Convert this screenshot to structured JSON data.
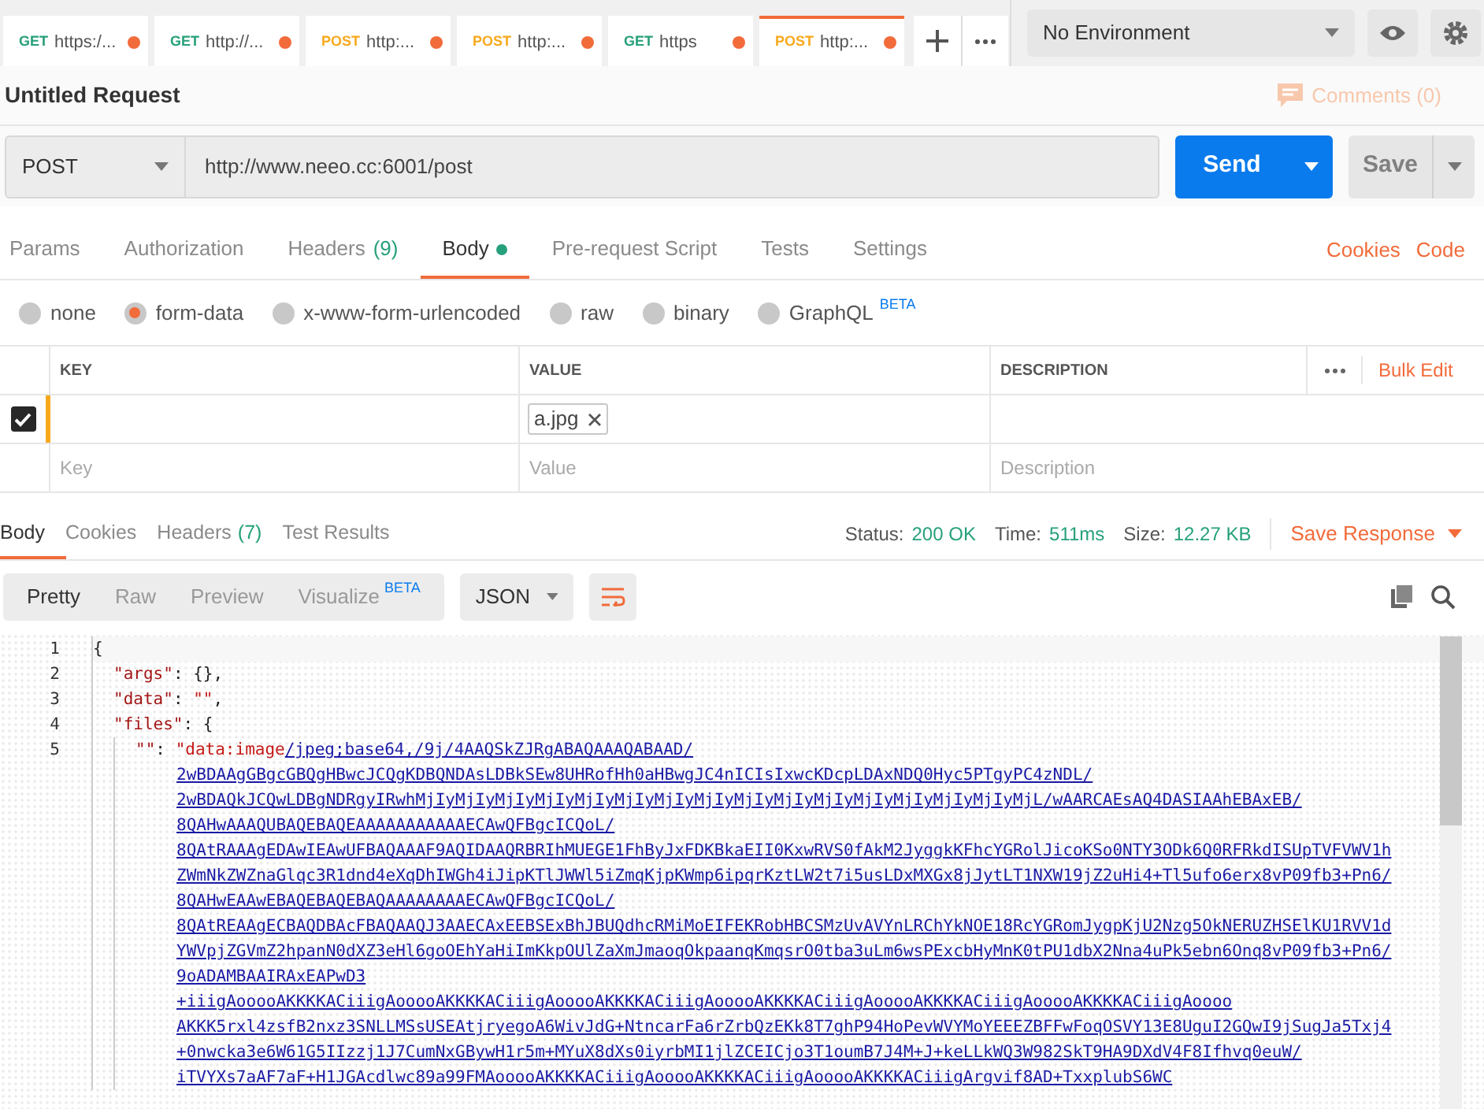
{
  "tabs": [
    {
      "method": "GET",
      "color": "#26a07b",
      "label": "https:/...",
      "unsaved": true,
      "selected": false
    },
    {
      "method": "GET",
      "color": "#26a07b",
      "label": "http://...",
      "unsaved": true,
      "selected": false
    },
    {
      "method": "POST",
      "color": "#f7a91e",
      "label": "http:...",
      "unsaved": true,
      "selected": false
    },
    {
      "method": "POST",
      "color": "#f7a91e",
      "label": "http:...",
      "unsaved": true,
      "selected": false
    },
    {
      "method": "GET",
      "color": "#26a07b",
      "label": "https",
      "unsaved": true,
      "selected": false
    },
    {
      "method": "POST",
      "color": "#f7a91e",
      "label": "http:...",
      "unsaved": true,
      "selected": true
    }
  ],
  "environment": {
    "value": "No Environment"
  },
  "request": {
    "title": "Untitled Request",
    "comments": "Comments (0)",
    "method": "POST",
    "url": "http://www.neeo.cc:6001/post",
    "send": "Send",
    "save": "Save"
  },
  "request_tabs": [
    {
      "label": "Params",
      "selected": false
    },
    {
      "label": "Authorization",
      "selected": false
    },
    {
      "label": "Headers",
      "count": "(9)",
      "selected": false
    },
    {
      "label": "Body",
      "dot": true,
      "selected": true
    },
    {
      "label": "Pre-request Script",
      "selected": false
    },
    {
      "label": "Tests",
      "selected": false
    },
    {
      "label": "Settings",
      "selected": false
    }
  ],
  "request_links": [
    "Cookies",
    "Code"
  ],
  "body_types": [
    {
      "label": "none",
      "selected": false
    },
    {
      "label": "form-data",
      "selected": true
    },
    {
      "label": "x-www-form-urlencoded",
      "selected": false
    },
    {
      "label": "raw",
      "selected": false
    },
    {
      "label": "binary",
      "selected": false
    },
    {
      "label": "GraphQL",
      "badge": "BETA",
      "selected": false
    }
  ],
  "params_table": {
    "columns": [
      "KEY",
      "VALUE",
      "DESCRIPTION"
    ],
    "bulk_edit": "Bulk Edit",
    "rows": [
      {
        "checked": true,
        "file": "a.jpg"
      }
    ],
    "new_row": [
      {
        "placeholder": "Key"
      },
      {
        "placeholder": "Value"
      },
      {
        "placeholder": "Description"
      }
    ]
  },
  "response": {
    "tabs": [
      {
        "label": "Body",
        "selected": true
      },
      {
        "label": "Cookies",
        "selected": false
      },
      {
        "label": "Headers",
        "count": "(7)",
        "selected": false
      },
      {
        "label": "Test Results",
        "selected": false
      }
    ],
    "stats": [
      {
        "label": "Status:",
        "value": "200 OK"
      },
      {
        "label": "Time:",
        "value": "511ms"
      },
      {
        "label": "Size:",
        "value": "12.27 KB"
      }
    ],
    "save_response": "Save Response",
    "view_modes": [
      {
        "label": "Pretty",
        "selected": true
      },
      {
        "label": "Raw",
        "selected": false
      },
      {
        "label": "Preview",
        "selected": false
      },
      {
        "label": "Visualize",
        "badge": "BETA",
        "selected": false
      }
    ],
    "format": "JSON",
    "code_lines": [
      {
        "number": "1",
        "parts": [
          {
            "kind": "punct",
            "text": "{"
          }
        ]
      },
      {
        "number": "2",
        "parts": [
          {
            "kind": "key",
            "text": "\"args\""
          },
          {
            "kind": "punct",
            "text": ": {},"
          }
        ]
      },
      {
        "number": "3",
        "parts": [
          {
            "kind": "key",
            "text": "\"data\""
          },
          {
            "kind": "punct",
            "text": ": "
          },
          {
            "kind": "string",
            "text": "\"\""
          },
          {
            "kind": "punct",
            "text": ","
          }
        ]
      },
      {
        "number": "4",
        "parts": [
          {
            "kind": "key",
            "text": "\"files\""
          },
          {
            "kind": "punct",
            "text": ": {"
          }
        ]
      },
      {
        "number": "5",
        "parts": [
          {
            "kind": "key",
            "text": "\"\""
          },
          {
            "kind": "punct",
            "text": ": "
          },
          {
            "kind": "string",
            "text": "\"data:image"
          },
          {
            "kind": "link",
            "text": "/jpeg;base64,/9j/4AAQSkZJRgABAQAAAQABAAD/"
          }
        ],
        "wrapped": [
          "2wBDAAgGBgcGBQgHBwcJCQgKDBQNDAsLDBkSEw8UHRofHh0aHBwgJC4nICIsIxwcKDcpLDAxNDQ0Hyc5PTgyPC4zNDL/",
          "2wBDAQkJCQwLDBgNDRgyIRwhMjIyMjIyMjIyMjIyMjIyMjIyMjIyMjIyMjIyMjIyMjIyMjIyMjIyMjIyMjIyMjL/wAARCAEsAQ4DASIAAhEBAxEB/",
          "8QAHwAAAQUBAQEBAQEAAAAAAAAAAAECAwQFBgcICQoL/",
          "8QAtRAAAgEDAwIEAwUFBAQAAAF9AQIDAAQRBRIhMUEGE1FhByJxFDKBkaEII0KxwRVS0fAkM2JyggkKFhcYGRolJicoKSo0NTY3ODk6Q0RFRkdISUpTVFVWV1h",
          "ZWmNkZWZnaGlqc3R1dnd4eXqDhIWGh4iJipKTlJWWl5iZmqKjpKWmp6ipqrKztLW2t7i5usLDxMXGx8jJytLT1NXW19jZ2uHi4+Tl5ufo6erx8vP09fb3+Pn6/",
          "8QAHwEAAwEBAQEBAQEBAQAAAAAAAAECAwQFBgcICQoL/",
          "8QAtREAAgECBAQDBAcFBAQAAQJ3AAECAxEEBSExBhJBUQdhcRMiMoEIFEKRobHBCSMzUvAVYnLRChYkNOE18RcYGRomJygpKjU2Nzg5OkNERUZHSElKU1RVV1d",
          "YWVpjZGVmZ2hpanN0dXZ3eHl6goOEhYaHiImKkpOUlZaXmJmaoqOkpaanqKmqsrO0tba3uLm6wsPExcbHyMnK0tPU1dbX2Nna4uPk5ebn6Onq8vP09fb3+Pn6/",
          "9oADAMBAAIRAxEAPwD3",
          "+iiigAooooAKKKKACiiigAooooAKKKKACiiigAooooAKKKKACiiigAooooAKKKKACiiigAooooAKKKKACiiigAooooAKKKKACiiigAoooo",
          "AKKK5rxl4zsfB2nxz3SNLLMSsUSEAtjryegoA6WivJdG+NtncarFa6rZrbQzEKk8T7ghP94HoPevWVYMoYEEEZBFFwFoqOSVY13E8UguI2GQwI9jSugJa5Txj4",
          "+0nwcka3e6W61G5IIzzj1J7CumNxGBywH1r5m+MYuX8dXs0iyrbMI1jlZCEICjo3T1oumB7J4M+J+keLLkWQ3W982SkT9HA9DXdV4F8Ifhvq0euW/",
          "iTVYXs7aAF7aF+H1JGAcdlwc89a99FMAooooAKKKKACiiigAooooAKKKKACiiigAooooAKKKKACiiigArgvif8AD+TxxplubS6WC"
        ]
      }
    ]
  }
}
